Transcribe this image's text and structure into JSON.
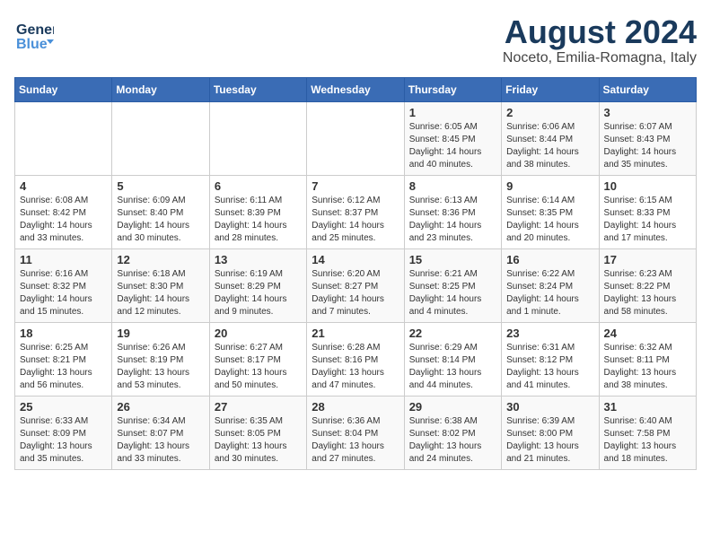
{
  "logo": {
    "line1": "General",
    "line2": "Blue"
  },
  "title": "August 2024",
  "location": "Noceto, Emilia-Romagna, Italy",
  "days_of_week": [
    "Sunday",
    "Monday",
    "Tuesday",
    "Wednesday",
    "Thursday",
    "Friday",
    "Saturday"
  ],
  "weeks": [
    [
      {
        "day": "",
        "info": ""
      },
      {
        "day": "",
        "info": ""
      },
      {
        "day": "",
        "info": ""
      },
      {
        "day": "",
        "info": ""
      },
      {
        "day": "1",
        "info": "Sunrise: 6:05 AM\nSunset: 8:45 PM\nDaylight: 14 hours\nand 40 minutes."
      },
      {
        "day": "2",
        "info": "Sunrise: 6:06 AM\nSunset: 8:44 PM\nDaylight: 14 hours\nand 38 minutes."
      },
      {
        "day": "3",
        "info": "Sunrise: 6:07 AM\nSunset: 8:43 PM\nDaylight: 14 hours\nand 35 minutes."
      }
    ],
    [
      {
        "day": "4",
        "info": "Sunrise: 6:08 AM\nSunset: 8:42 PM\nDaylight: 14 hours\nand 33 minutes."
      },
      {
        "day": "5",
        "info": "Sunrise: 6:09 AM\nSunset: 8:40 PM\nDaylight: 14 hours\nand 30 minutes."
      },
      {
        "day": "6",
        "info": "Sunrise: 6:11 AM\nSunset: 8:39 PM\nDaylight: 14 hours\nand 28 minutes."
      },
      {
        "day": "7",
        "info": "Sunrise: 6:12 AM\nSunset: 8:37 PM\nDaylight: 14 hours\nand 25 minutes."
      },
      {
        "day": "8",
        "info": "Sunrise: 6:13 AM\nSunset: 8:36 PM\nDaylight: 14 hours\nand 23 minutes."
      },
      {
        "day": "9",
        "info": "Sunrise: 6:14 AM\nSunset: 8:35 PM\nDaylight: 14 hours\nand 20 minutes."
      },
      {
        "day": "10",
        "info": "Sunrise: 6:15 AM\nSunset: 8:33 PM\nDaylight: 14 hours\nand 17 minutes."
      }
    ],
    [
      {
        "day": "11",
        "info": "Sunrise: 6:16 AM\nSunset: 8:32 PM\nDaylight: 14 hours\nand 15 minutes."
      },
      {
        "day": "12",
        "info": "Sunrise: 6:18 AM\nSunset: 8:30 PM\nDaylight: 14 hours\nand 12 minutes."
      },
      {
        "day": "13",
        "info": "Sunrise: 6:19 AM\nSunset: 8:29 PM\nDaylight: 14 hours\nand 9 minutes."
      },
      {
        "day": "14",
        "info": "Sunrise: 6:20 AM\nSunset: 8:27 PM\nDaylight: 14 hours\nand 7 minutes."
      },
      {
        "day": "15",
        "info": "Sunrise: 6:21 AM\nSunset: 8:25 PM\nDaylight: 14 hours\nand 4 minutes."
      },
      {
        "day": "16",
        "info": "Sunrise: 6:22 AM\nSunset: 8:24 PM\nDaylight: 14 hours\nand 1 minute."
      },
      {
        "day": "17",
        "info": "Sunrise: 6:23 AM\nSunset: 8:22 PM\nDaylight: 13 hours\nand 58 minutes."
      }
    ],
    [
      {
        "day": "18",
        "info": "Sunrise: 6:25 AM\nSunset: 8:21 PM\nDaylight: 13 hours\nand 56 minutes."
      },
      {
        "day": "19",
        "info": "Sunrise: 6:26 AM\nSunset: 8:19 PM\nDaylight: 13 hours\nand 53 minutes."
      },
      {
        "day": "20",
        "info": "Sunrise: 6:27 AM\nSunset: 8:17 PM\nDaylight: 13 hours\nand 50 minutes."
      },
      {
        "day": "21",
        "info": "Sunrise: 6:28 AM\nSunset: 8:16 PM\nDaylight: 13 hours\nand 47 minutes."
      },
      {
        "day": "22",
        "info": "Sunrise: 6:29 AM\nSunset: 8:14 PM\nDaylight: 13 hours\nand 44 minutes."
      },
      {
        "day": "23",
        "info": "Sunrise: 6:31 AM\nSunset: 8:12 PM\nDaylight: 13 hours\nand 41 minutes."
      },
      {
        "day": "24",
        "info": "Sunrise: 6:32 AM\nSunset: 8:11 PM\nDaylight: 13 hours\nand 38 minutes."
      }
    ],
    [
      {
        "day": "25",
        "info": "Sunrise: 6:33 AM\nSunset: 8:09 PM\nDaylight: 13 hours\nand 35 minutes."
      },
      {
        "day": "26",
        "info": "Sunrise: 6:34 AM\nSunset: 8:07 PM\nDaylight: 13 hours\nand 33 minutes."
      },
      {
        "day": "27",
        "info": "Sunrise: 6:35 AM\nSunset: 8:05 PM\nDaylight: 13 hours\nand 30 minutes."
      },
      {
        "day": "28",
        "info": "Sunrise: 6:36 AM\nSunset: 8:04 PM\nDaylight: 13 hours\nand 27 minutes."
      },
      {
        "day": "29",
        "info": "Sunrise: 6:38 AM\nSunset: 8:02 PM\nDaylight: 13 hours\nand 24 minutes."
      },
      {
        "day": "30",
        "info": "Sunrise: 6:39 AM\nSunset: 8:00 PM\nDaylight: 13 hours\nand 21 minutes."
      },
      {
        "day": "31",
        "info": "Sunrise: 6:40 AM\nSunset: 7:58 PM\nDaylight: 13 hours\nand 18 minutes."
      }
    ]
  ]
}
